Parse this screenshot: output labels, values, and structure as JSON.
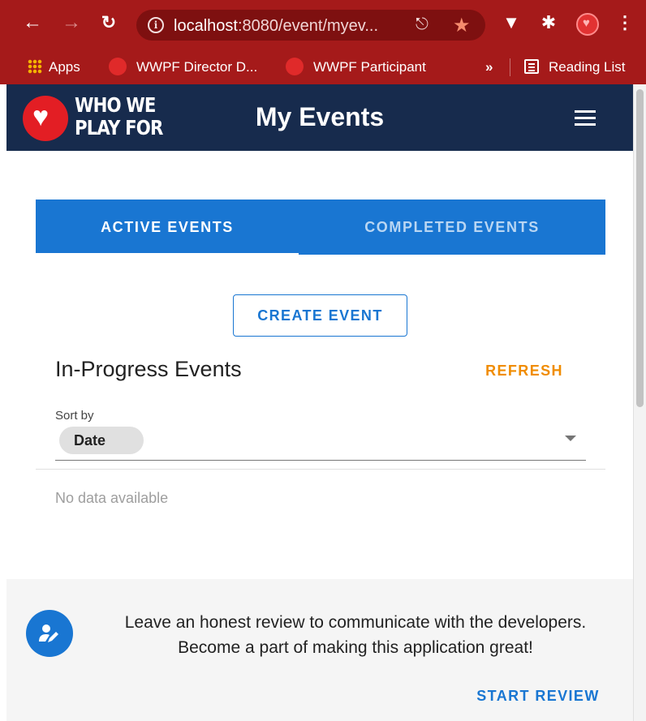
{
  "browser": {
    "url_host": "localhost",
    "url_rest": ":8080/event/myev...",
    "bookmarks": {
      "apps": "Apps",
      "item1": "WWPF Director D...",
      "item2": "WWPF Participant",
      "overflow": "»",
      "reading_list": "Reading List"
    }
  },
  "app": {
    "logo_line1": "WHO WE",
    "logo_line2": "PLAY FOR",
    "title": "My Events"
  },
  "tabs": {
    "active": "ACTIVE EVENTS",
    "completed": "COMPLETED EVENTS"
  },
  "actions": {
    "create": "CREATE EVENT",
    "refresh": "REFRESH"
  },
  "events": {
    "section_title": "In-Progress Events",
    "sort_label": "Sort by",
    "sort_value": "Date",
    "empty_text": "No data available"
  },
  "review": {
    "line1": "Leave an honest review to communicate with the developers.",
    "line2": "Become a part of making this application great!",
    "button": "START REVIEW"
  },
  "colors": {
    "chrome": "#a51a1a",
    "appbar": "#172b4d",
    "primary": "#1976d2",
    "accent": "#f08c00"
  }
}
